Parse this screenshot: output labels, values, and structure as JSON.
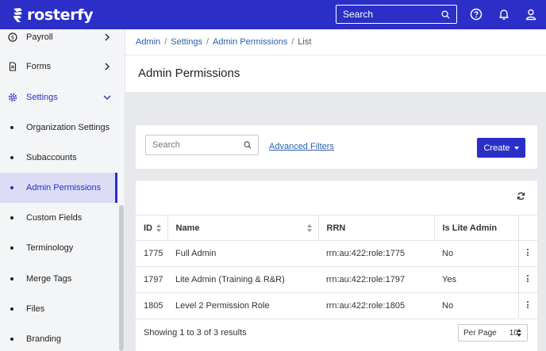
{
  "app": {
    "brand": "rosterfy",
    "search_placeholder": "Search"
  },
  "sidebar": {
    "items": [
      {
        "label": "Payroll",
        "icon": "dollar-icon"
      },
      {
        "label": "Forms",
        "icon": "document-icon"
      },
      {
        "label": "Settings",
        "icon": "gear-icon"
      }
    ],
    "sub_items": [
      {
        "label": "Organization Settings"
      },
      {
        "label": "Subaccounts"
      },
      {
        "label": "Admin Permissions"
      },
      {
        "label": "Custom Fields"
      },
      {
        "label": "Terminology"
      },
      {
        "label": "Merge Tags"
      },
      {
        "label": "Files"
      },
      {
        "label": "Branding"
      }
    ]
  },
  "breadcrumb": [
    "Admin",
    "Settings",
    "Admin Permissions",
    "List"
  ],
  "page": {
    "title": "Admin Permissions"
  },
  "filters": {
    "search_placeholder": "Search",
    "advanced_filters": "Advanced Filters",
    "create_label": "Create"
  },
  "table": {
    "columns": [
      "ID",
      "Name",
      "RRN",
      "Is Lite Admin"
    ],
    "rows": [
      {
        "id": "1775",
        "name": "Full Admin",
        "rrn": "rrn:au:422:role:1775",
        "lite": "No"
      },
      {
        "id": "1797",
        "name": "Lite Admin (Training & R&R)",
        "rrn": "rrn:au:422:role:1797",
        "lite": "Yes"
      },
      {
        "id": "1805",
        "name": "Level 2 Permission Role",
        "rrn": "rrn:au:422:role:1805",
        "lite": "No"
      }
    ],
    "footer": "Showing 1 to 3 of 3 results",
    "per_page_label": "Per Page",
    "per_page_value": "10"
  },
  "colors": {
    "brand": "#2b2fc7",
    "link": "#2b5fa8",
    "active_bg": "#dcdcf5"
  }
}
